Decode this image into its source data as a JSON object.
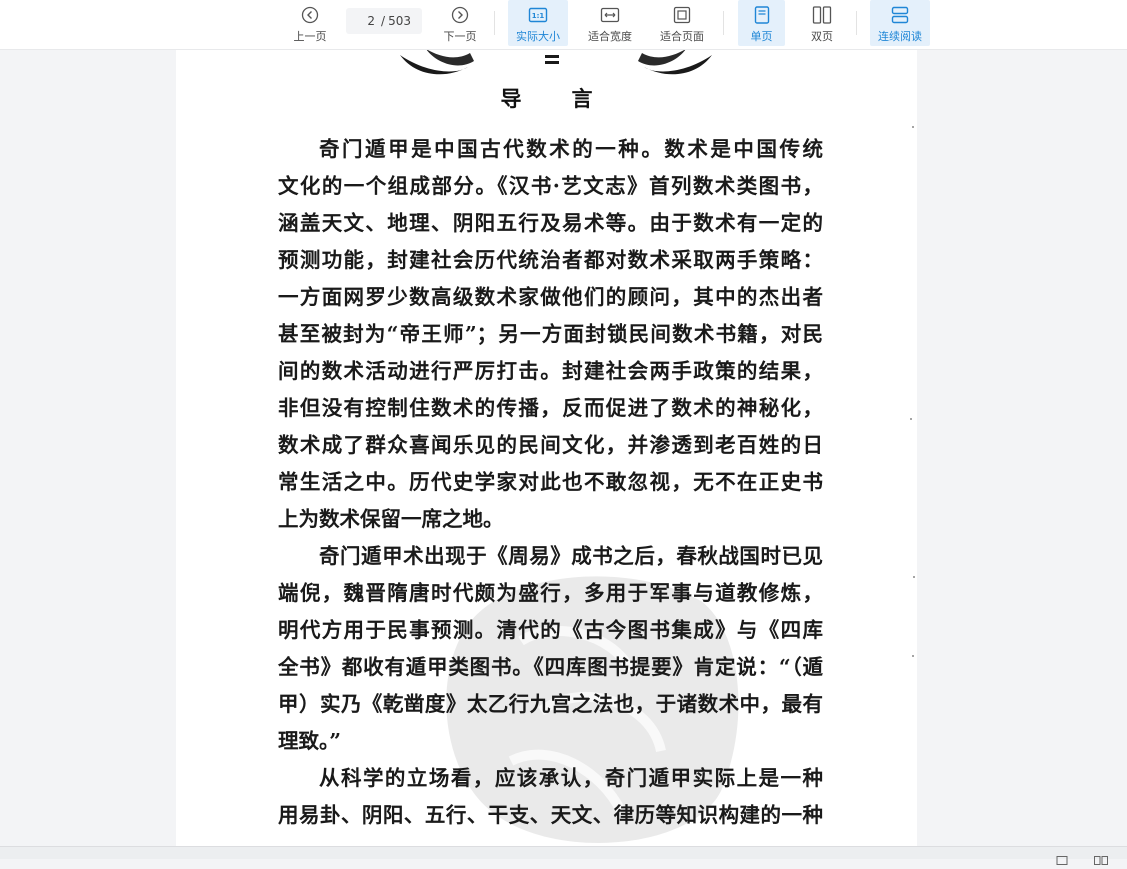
{
  "toolbar": {
    "prev_label": "上一页",
    "next_label": "下一页",
    "current_page": "2",
    "total_pages": "503",
    "actual_size_label": "实际大小",
    "fit_width_label": "适合宽度",
    "fit_page_label": "适合页面",
    "single_page_label": "单页",
    "double_page_label": "双页",
    "continuous_label": "连续阅读",
    "accent_color": "#1f86d6",
    "active_bg": "#e4f0fb"
  },
  "document": {
    "title": "导言",
    "paragraphs": [
      {
        "lines": [
          "奇门遁甲是中国古代数术的一种。数术是中国传统",
          "文化的一个组成部分。《汉书·艺文志》首列数术类图书，",
          "涵盖天文、地理、阴阳五行及易术等。由于数术有一定的",
          "预测功能，封建社会历代统治者都对数术采取两手策略：",
          "一方面网罗少数高级数术家做他们的顾问，其中的杰出者",
          "甚至被封为“帝王师”；另一方面封锁民间数术书籍，对民",
          "间的数术活动进行严厉打击。封建社会两手政策的结果，",
          "非但没有控制住数术的传播，反而促进了数术的神秘化，",
          "数术成了群众喜闻乐见的民间文化，并渗透到老百姓的日",
          "常生活之中。历代史学家对此也不敢忽视，无不在正史书",
          "上为数术保留一席之地。"
        ]
      },
      {
        "lines": [
          "奇门遁甲术出现于《周易》成书之后，春秋战国时已见",
          "端倪，魏晋隋唐时代颇为盛行，多用于军事与道教修炼，",
          "明代方用于民事预测。清代的《古今图书集成》与《四库",
          "全书》都收有遁甲类图书。《四库图书提要》肯定说：“（遁",
          "甲）实乃《乾凿度》太乙行九宫之法也，于诸数术中，最有",
          "理致。”"
        ]
      },
      {
        "lines": [
          "从科学的立场看，应该承认，奇门遁甲实际上是一种",
          "用易卦、阴阳、五行、干支、天文、律历等知识构建的一种"
        ]
      }
    ]
  }
}
